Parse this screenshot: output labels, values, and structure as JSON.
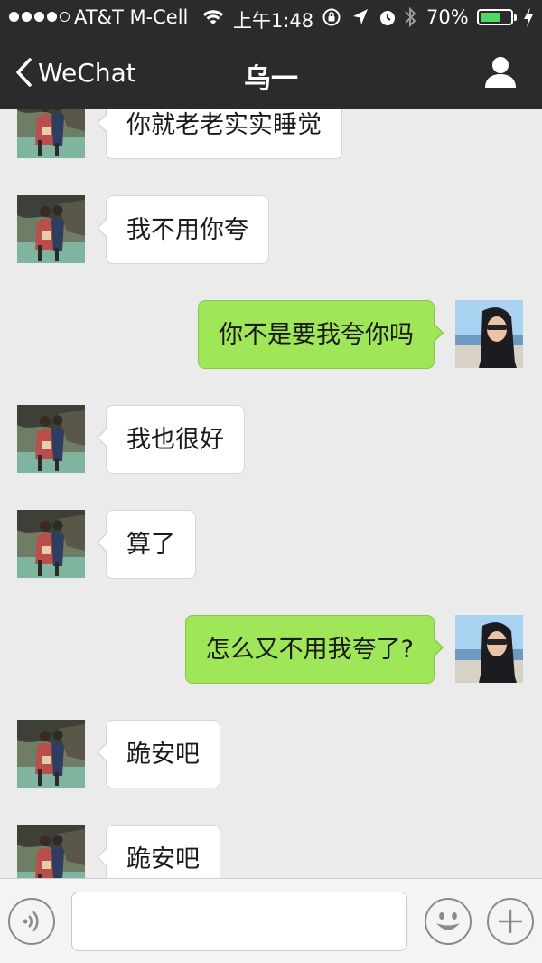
{
  "status_bar": {
    "signal_dots": 5,
    "signal_filled": 4,
    "carrier": "AT&T M-Cell",
    "time": "上午1:48",
    "battery_text": "70%",
    "battery_level": 0.7,
    "battery_color": "#4cd964"
  },
  "nav": {
    "back_label": "WeChat",
    "title": "乌一",
    "back_icon": "chevron-left-icon",
    "profile_icon": "person-icon"
  },
  "messages": [
    {
      "side": "in",
      "text": "你就老老实实睡觉"
    },
    {
      "side": "in",
      "text": "我不用你夸"
    },
    {
      "side": "out",
      "text": "你不是要我夸你吗"
    },
    {
      "side": "in",
      "text": "我也很好"
    },
    {
      "side": "in",
      "text": "算了"
    },
    {
      "side": "out",
      "text": "怎么又不用我夸了?"
    },
    {
      "side": "in",
      "text": "跪安吧"
    },
    {
      "side": "in",
      "text": "跪安吧"
    }
  ],
  "input_bar": {
    "voice_icon": "voice-icon",
    "emoji_icon": "emoji-icon",
    "plus_icon": "plus-icon",
    "input_value": ""
  },
  "colors": {
    "nav_background": "#2b2b2d",
    "chat_background": "#ebebeb",
    "outgoing_bubble": "#9fe658",
    "incoming_bubble": "#ffffff"
  }
}
